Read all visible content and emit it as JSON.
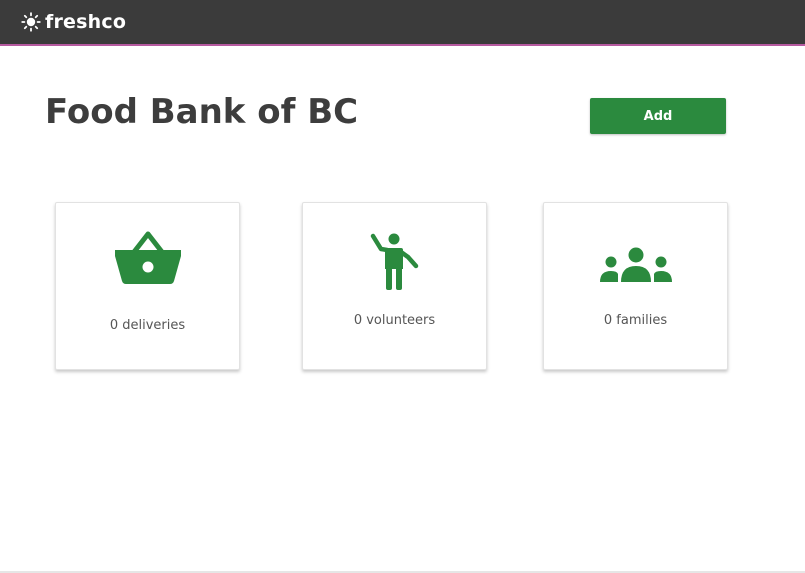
{
  "app": {
    "brand_name": "freshco",
    "logo_icon": "sun-icon"
  },
  "colors": {
    "topbar_background": "#3b3b3b",
    "topbar_accent": "#b65aa0",
    "primary_green": "#2b8a3e",
    "title_text": "#3d3d3d",
    "label_text": "#555555"
  },
  "header": {
    "title": "Food Bank of BC",
    "add_label": "Add"
  },
  "cards": [
    {
      "icon": "basket-icon",
      "label": "0 deliveries"
    },
    {
      "icon": "volunteer-icon",
      "label": "0 volunteers"
    },
    {
      "icon": "group-icon",
      "label": "0 families"
    }
  ]
}
